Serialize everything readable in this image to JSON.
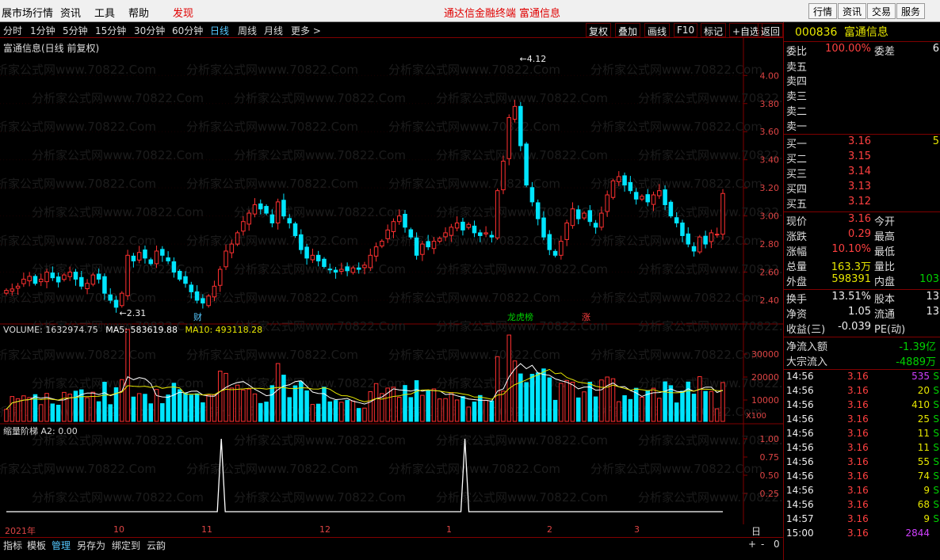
{
  "menu": {
    "items": [
      "展市场行情",
      "资讯",
      "工具",
      "帮助",
      "发现"
    ],
    "center_left": "通达信金融终端",
    "center_right": "富通信息",
    "buttons": [
      "行情",
      "资讯",
      "交易",
      "服务"
    ]
  },
  "period": {
    "items": [
      "分时",
      "1分钟",
      "5分钟",
      "15分钟",
      "30分钟",
      "60分钟",
      "日线",
      "周线",
      "月线",
      "更多 >"
    ],
    "active": "日线",
    "right": [
      "复权",
      "叠加",
      "画线",
      "F10",
      "标记",
      "+自选",
      "返回"
    ]
  },
  "price_panel": {
    "title": "富通信息(日线 前复权)",
    "high_label": "4.12",
    "low_label": "2.31",
    "y_ticks": [
      "4.00",
      "3.80",
      "3.60",
      "3.40",
      "3.20",
      "3.00",
      "2.80",
      "2.60",
      "2.40"
    ],
    "markers": [
      "财",
      "龙虎榜",
      "涨"
    ],
    "watermark": "分析家公式网www.70822.Com"
  },
  "volume_panel": {
    "label": "VOLUME: 1632974.75",
    "ma5": "MA5: 583619.88",
    "ma10": "MA10: 493118.28",
    "y_ticks": [
      "30000",
      "20000",
      "10000"
    ],
    "unit": "X100"
  },
  "indicator_panel": {
    "label": "缩量阶梯  A2: 0.00",
    "y_ticks": [
      "1.00",
      "0.75",
      "0.50",
      "0.25"
    ]
  },
  "time_axis": {
    "labels": [
      "2021年",
      "10",
      "11",
      "12",
      "1",
      "2",
      "3"
    ],
    "period": "日线"
  },
  "bottom_tabs": {
    "items": [
      "指标",
      "模板",
      "管理",
      "另存为",
      "绑定到",
      "云韵"
    ],
    "active": "管理",
    "controls": [
      "+",
      "-",
      "0"
    ]
  },
  "quote": {
    "code": "000836",
    "name": "富通信息",
    "rows": [
      {
        "l": "委比",
        "v": "100.00%",
        "l2": "委差",
        "v2": "6"
      },
      {
        "l": "卖五",
        "v": ""
      },
      {
        "l": "卖四",
        "v": ""
      },
      {
        "l": "卖三",
        "v": ""
      },
      {
        "l": "卖二",
        "v": ""
      },
      {
        "l": "卖一",
        "v": ""
      },
      {
        "l": "买一",
        "v": "3.16",
        "v2": "5"
      },
      {
        "l": "买二",
        "v": "3.15"
      },
      {
        "l": "买三",
        "v": "3.14"
      },
      {
        "l": "买四",
        "v": "3.13"
      },
      {
        "l": "买五",
        "v": "3.12"
      },
      {
        "l": "现价",
        "v": "3.16",
        "l2": "今开",
        "v2": ""
      },
      {
        "l": "涨跌",
        "v": "0.29",
        "l2": "最高",
        "v2": ""
      },
      {
        "l": "涨幅",
        "v": "10.10%",
        "l2": "最低",
        "v2": ""
      },
      {
        "l": "总量",
        "v": "163.3万",
        "l2": "量比",
        "v2": ""
      },
      {
        "l": "外盘",
        "v": "598391",
        "l2": "内盘",
        "v2": "103"
      },
      {
        "l": "换手",
        "v": "13.51%",
        "l2": "股本",
        "v2": "13"
      },
      {
        "l": "净资",
        "v": "1.05",
        "l2": "流通",
        "v2": "13"
      },
      {
        "l": "收益(三)",
        "v": "-0.039",
        "l2": "PE(动)",
        "v2": ""
      },
      {
        "l": "净流入额",
        "v": "-1.39亿"
      },
      {
        "l": "大宗流入",
        "v": "-4889万"
      }
    ],
    "ticks": [
      {
        "t": "14:56",
        "p": "3.16",
        "q": "535",
        "s": "S"
      },
      {
        "t": "14:56",
        "p": "3.16",
        "q": "20",
        "s": "S"
      },
      {
        "t": "14:56",
        "p": "3.16",
        "q": "410",
        "s": "S"
      },
      {
        "t": "14:56",
        "p": "3.16",
        "q": "25",
        "s": "S"
      },
      {
        "t": "14:56",
        "p": "3.16",
        "q": "11",
        "s": "S"
      },
      {
        "t": "14:56",
        "p": "3.16",
        "q": "11",
        "s": "S"
      },
      {
        "t": "14:56",
        "p": "3.16",
        "q": "55",
        "s": "S"
      },
      {
        "t": "14:56",
        "p": "3.16",
        "q": "74",
        "s": "S"
      },
      {
        "t": "14:56",
        "p": "3.16",
        "q": "9",
        "s": "S"
      },
      {
        "t": "14:56",
        "p": "3.16",
        "q": "68",
        "s": "S"
      },
      {
        "t": "14:57",
        "p": "3.16",
        "q": "9",
        "s": "S"
      },
      {
        "t": "15:00",
        "p": "3.16",
        "q": "2844",
        "s": ""
      }
    ]
  },
  "colors": {
    "up": "#ff3030",
    "down": "#00e5ff",
    "ma5": "#ffffff",
    "ma10": "#e6e600",
    "border": "#800000"
  },
  "chart_data": {
    "type": "candlestick",
    "x_range": [
      "2021-09",
      "2022-03"
    ],
    "ylim": [
      2.31,
      4.12
    ],
    "closes": [
      2.47,
      2.48,
      2.5,
      2.55,
      2.57,
      2.52,
      2.55,
      2.6,
      2.56,
      2.53,
      2.58,
      2.6,
      2.55,
      2.5,
      2.52,
      2.58,
      2.55,
      2.45,
      2.4,
      2.35,
      2.45,
      2.72,
      2.68,
      2.74,
      2.7,
      2.66,
      2.75,
      2.72,
      2.68,
      2.6,
      2.55,
      2.52,
      2.46,
      2.4,
      2.38,
      2.43,
      2.5,
      2.62,
      2.75,
      2.8,
      2.88,
      2.96,
      3.02,
      3.08,
      3.05,
      3.02,
      2.95,
      3.1,
      3.0,
      2.95,
      2.86,
      2.76,
      2.7,
      2.72,
      2.68,
      2.64,
      2.62,
      2.6,
      2.62,
      2.61,
      2.63,
      2.62,
      2.65,
      2.72,
      2.78,
      2.82,
      2.9,
      2.96,
      3.0,
      2.92,
      2.85,
      2.72,
      2.8,
      2.78,
      2.82,
      2.84,
      2.88,
      2.92,
      2.95,
      2.9,
      2.94,
      2.88,
      2.86,
      2.88,
      2.85,
      3.18,
      3.39,
      3.7,
      3.78,
      3.5,
      3.22,
      3.1,
      2.98,
      2.85,
      2.76,
      2.72,
      2.82,
      2.95,
      3.05,
      2.98,
      3.02,
      2.96,
      2.92,
      3.02,
      3.15,
      3.25,
      3.28,
      3.22,
      3.18,
      3.12,
      3.14,
      3.1,
      3.15,
      3.18,
      3.08,
      3.0,
      2.95,
      2.86,
      2.8,
      2.75,
      2.85,
      2.8,
      2.88,
      2.87,
      3.16
    ],
    "ind_peaks": [
      0.3,
      0.64
    ]
  }
}
